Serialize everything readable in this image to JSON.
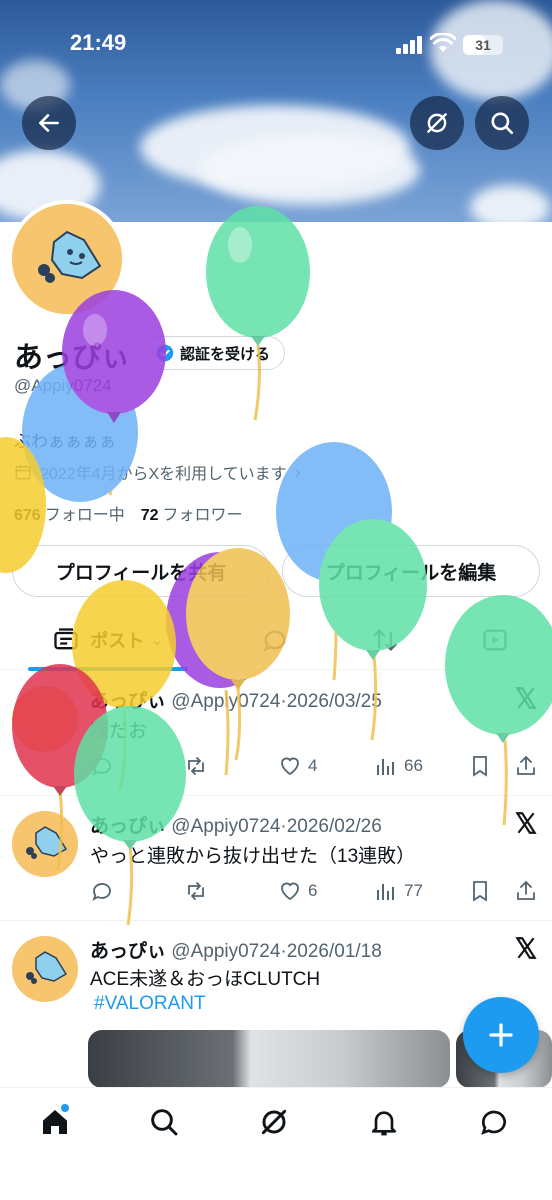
{
  "status_bar": {
    "time": "21:49",
    "battery": "31"
  },
  "header": {
    "back_icon": "arrow-left-icon",
    "grok_icon": "grok-icon",
    "search_icon": "search-icon"
  },
  "profile": {
    "display_name": "あっぴぃ",
    "verify_label": "認証を受ける",
    "handle": "@Appiy0724",
    "bio": "ぶわぁぁぁぁ",
    "joined": "2022年4月からXを利用しています",
    "following_count": "676",
    "following_label": "フォロー中",
    "followers_count": "72",
    "followers_label": "フォロワー",
    "share_button": "プロフィールを共有",
    "edit_button": "プロフィールを編集"
  },
  "tabs": {
    "posts_label": "ポスト"
  },
  "tweets": [
    {
      "name": "あっぴぃ",
      "meta": "@Appiy0724·2026/03/25",
      "text": "喋だお",
      "likes": "4",
      "views": "66"
    },
    {
      "name": "あっぴぃ",
      "meta": "@Appiy0724·2026/02/26",
      "text": "やっと連敗から抜け出せた（13連敗）",
      "likes": "6",
      "views": "77"
    },
    {
      "name": "あっぴぃ",
      "meta": "@Appiy0724·2026/01/18",
      "text": "ACE未遂＆おっほCLUTCH",
      "hashtag": "#VALORANT"
    }
  ],
  "colors": {
    "accent": "#1d9bf0",
    "avatar_bg": "#f6c56d"
  }
}
